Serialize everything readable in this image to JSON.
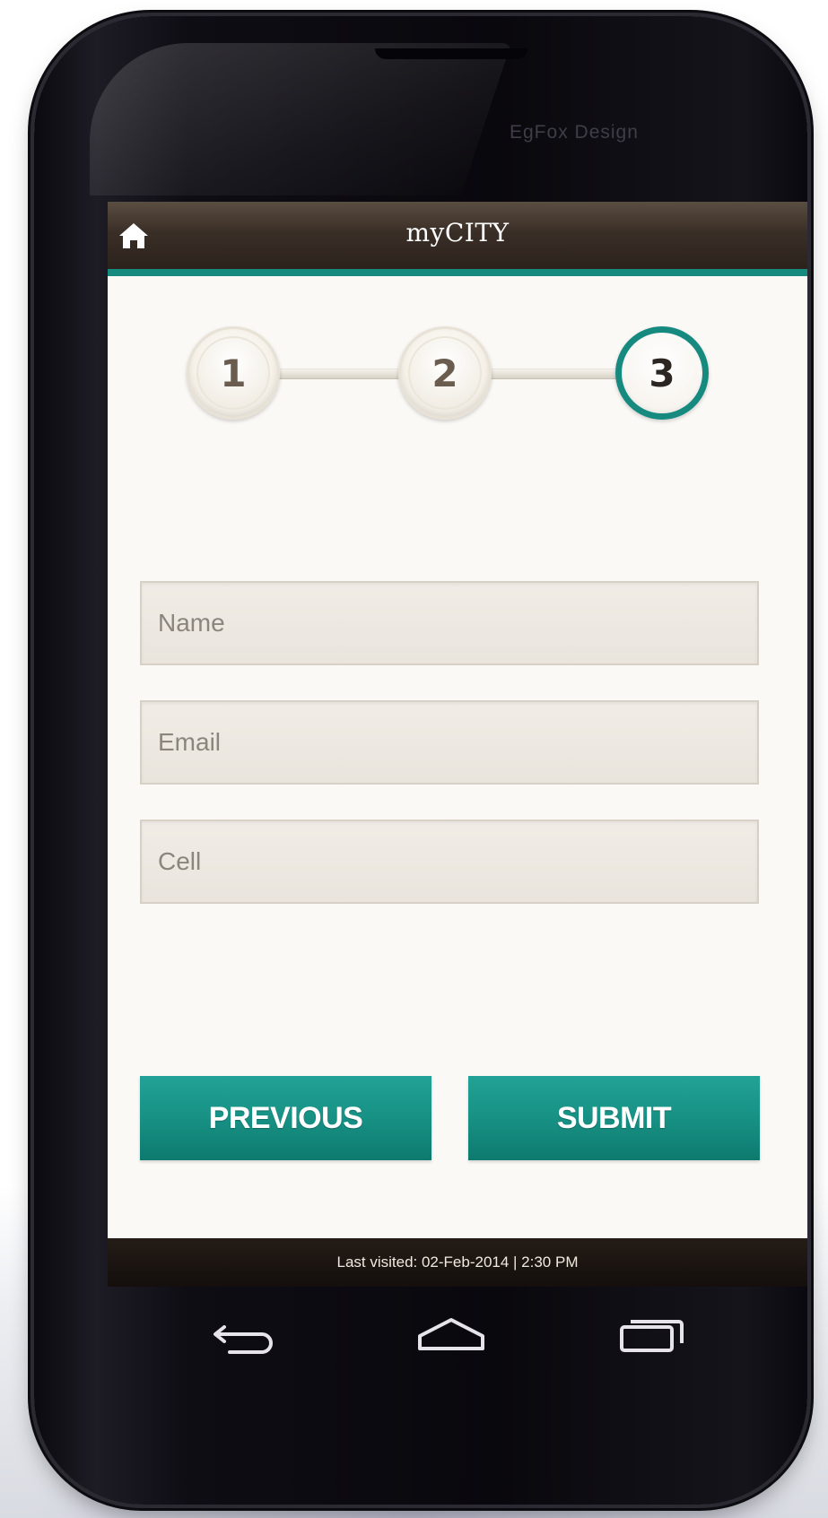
{
  "device": {
    "brand_text": "EgFox Design"
  },
  "header": {
    "title": "myCITY",
    "home_icon": "home-icon"
  },
  "stepper": {
    "steps": [
      {
        "label": "1",
        "state": "inactive"
      },
      {
        "label": "2",
        "state": "inactive"
      },
      {
        "label": "3",
        "state": "active"
      }
    ],
    "active_color": "#178a80"
  },
  "form": {
    "name": {
      "placeholder": "Name",
      "value": ""
    },
    "email": {
      "placeholder": "Email",
      "value": ""
    },
    "cell": {
      "placeholder": "Cell",
      "value": ""
    }
  },
  "buttons": {
    "previous_label": "PREVIOUS",
    "submit_label": "SUBMIT",
    "color": "#179184"
  },
  "footer": {
    "last_visited": "Last visited: 02-Feb-2014 | 2:30 PM"
  },
  "nav_keys": [
    "back-icon",
    "home-icon",
    "recent-apps-icon"
  ],
  "colors": {
    "accent": "#178a80",
    "header_brown": "#3a2f27",
    "screen_bg": "#fbf9f6"
  }
}
